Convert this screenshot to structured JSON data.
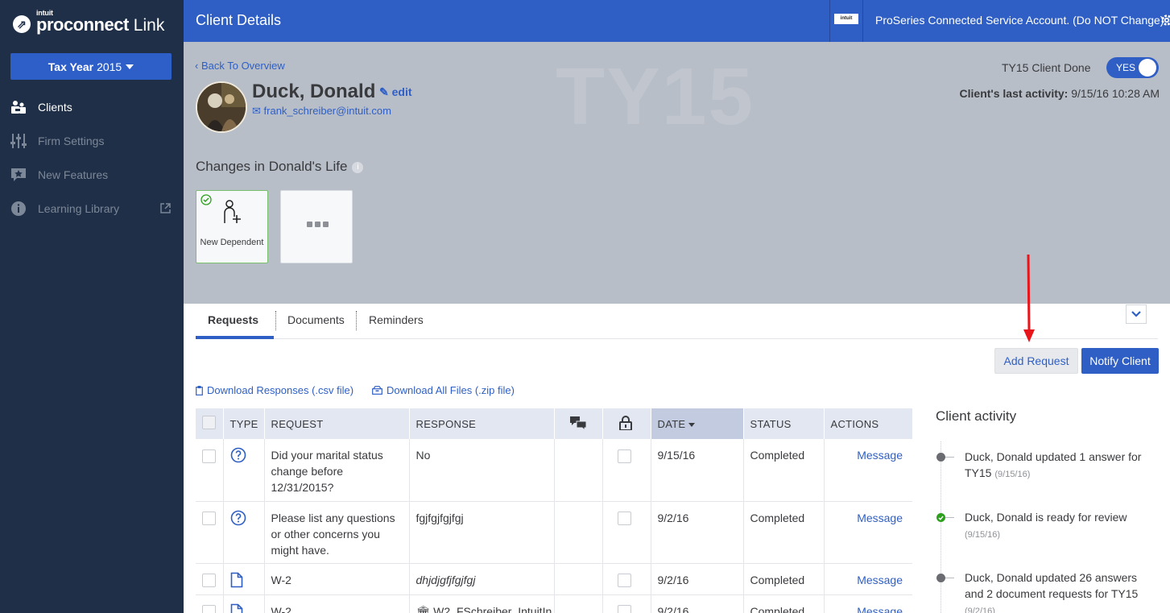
{
  "sidebar": {
    "brand_small": "intuit",
    "brand_main": "proconnect",
    "brand_link": "Link",
    "tax_year_prefix": "Tax Year",
    "tax_year_value": "2015",
    "items": [
      {
        "label": "Clients",
        "icon": "clients-icon",
        "active": true
      },
      {
        "label": "Firm Settings",
        "icon": "sliders-icon",
        "active": false
      },
      {
        "label": "New Features",
        "icon": "star-badge-icon",
        "active": false
      },
      {
        "label": "Learning Library",
        "icon": "info-icon",
        "active": false
      }
    ]
  },
  "topbar": {
    "title": "Client Details",
    "logo_text": "intuit",
    "account": "ProSeries Connected Service Account. (Do NOT Change)"
  },
  "client": {
    "back_link": "Back To Overview",
    "watermark": "TY15",
    "name": "Duck, Donald",
    "edit_label": "edit",
    "email": "frank_schreiber@intuit.com",
    "done_label": "TY15 Client Done",
    "done_toggle": "YES",
    "last_activity_label": "Client's last activity:",
    "last_activity_value": "9/15/16 10:28 AM",
    "changes_title": "Changes in Donald's Life",
    "info_glyph": "i",
    "cards": [
      {
        "label": "New Dependent",
        "selected": true
      },
      {
        "label": "",
        "selected": false
      }
    ]
  },
  "tabs": [
    {
      "label": "Requests",
      "active": true
    },
    {
      "label": "Documents",
      "active": false
    },
    {
      "label": "Reminders",
      "active": false
    }
  ],
  "actions": {
    "add_request": "Add Request",
    "notify_client": "Notify Client",
    "download_responses": "Download Responses (.csv file)",
    "download_all": "Download All Files (.zip file)"
  },
  "table": {
    "headers": {
      "type": "TYPE",
      "request": "REQUEST",
      "response": "RESPONSE",
      "date": "DATE",
      "status": "STATUS",
      "actions": "ACTIONS"
    },
    "rows": [
      {
        "type": "question",
        "request": "Did your marital status change before 12/31/2015?",
        "response": "No",
        "date": "9/15/16",
        "status": "Completed",
        "action": "Message"
      },
      {
        "type": "question",
        "request": "Please list any questions or other concerns you might have.",
        "response": "fgjfgjfgjfgj",
        "date": "9/2/16",
        "status": "Completed",
        "action": "Message"
      },
      {
        "type": "document",
        "request": "W-2",
        "response": "dhjdjgfjfgjfgj",
        "date": "9/2/16",
        "status": "Completed",
        "action": "Message"
      },
      {
        "type": "document",
        "request": "W-2",
        "response": "W2_FSchreiber_IntuitIn",
        "date": "9/2/16",
        "status": "Completed",
        "action": "Message"
      }
    ]
  },
  "activity": {
    "title": "Client activity",
    "items": [
      {
        "text": "Duck, Donald updated 1 answer for TY15",
        "time": "(9/15/16)",
        "status": "gray"
      },
      {
        "text": "Duck, Donald is ready for review",
        "time": "(9/15/16)",
        "status": "green"
      },
      {
        "text": "Duck, Donald updated 26 answers and 2 document requests for TY15",
        "time": "(9/2/16)",
        "status": "gray"
      }
    ]
  },
  "colors": {
    "sidebar_bg": "#1f2f48",
    "brand_blue": "#2f5fc4",
    "header_band": "#b8bec7",
    "annotation_arrow": "#e8151b"
  }
}
